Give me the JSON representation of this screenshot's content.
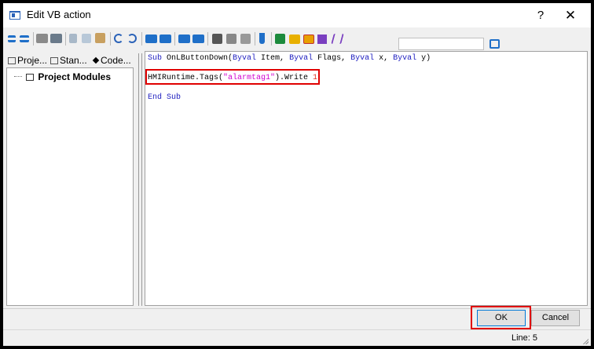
{
  "window": {
    "title": "Edit VB action",
    "help_glyph": "?",
    "close_glyph": "✕"
  },
  "toolbar": {
    "icons": [
      "align-left-icon",
      "align-right-icon",
      "print-icon",
      "print-preview-icon",
      "cut-icon",
      "copy-icon",
      "paste-icon",
      "undo-icon",
      "redo-icon",
      "indent-icon",
      "outdent-icon",
      "comment-icon",
      "uncomment-icon",
      "find-icon",
      "replace-icon",
      "goto-icon",
      "bookmark-icon",
      "syntax-check-icon",
      "tag-icon",
      "object-icon",
      "font-icon",
      "lambda-icon"
    ],
    "colors": {
      "blue": "#1f6fc8",
      "green": "#1c8a3c",
      "yellow": "#e8b000",
      "gray": "#777777",
      "red": "#c03030",
      "purple": "#7a3fc0"
    }
  },
  "tree": {
    "tabs": [
      {
        "label": "Proje...",
        "icon": "module-icon"
      },
      {
        "label": "Stan...",
        "icon": "module-icon"
      },
      {
        "label": "Code...",
        "icon": "diamond-icon"
      }
    ],
    "root": {
      "label": "Project Modules"
    }
  },
  "editor": {
    "line1": {
      "kw1": "Sub",
      "name": " OnLButtonDown(",
      "kw2": "Byval",
      "p1": " Item, ",
      "kw3": "Byval",
      "p2": " Flags, ",
      "kw4": "Byval",
      "p3": " x, ",
      "kw5": "Byval",
      "p4": " y)"
    },
    "line2": {
      "pre": "HMIRuntime.Tags(",
      "str": "\"alarmtag1\"",
      "mid": ").Write ",
      "num": "1"
    },
    "line3": {
      "kw": "End Sub"
    }
  },
  "buttons": {
    "ok": "OK",
    "cancel": "Cancel"
  },
  "status": {
    "line": "Line: 5"
  }
}
